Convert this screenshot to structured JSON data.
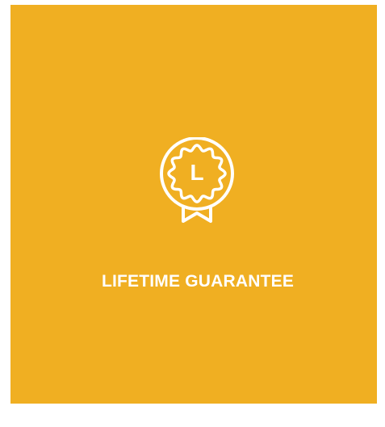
{
  "feature": {
    "icon": "award-badge-icon",
    "badge_letter": "L",
    "title": "LIFETIME GUARANTEE"
  },
  "colors": {
    "background": "#F0AF22",
    "foreground": "#FFFFFF"
  }
}
